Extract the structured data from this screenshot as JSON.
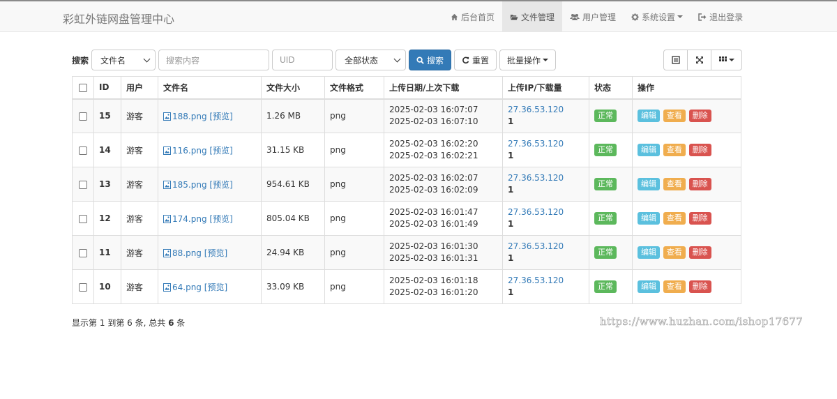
{
  "app": {
    "title": "彩虹外链网盘管理中心"
  },
  "nav": {
    "items": [
      {
        "label": "后台首页",
        "icon": "home-icon"
      },
      {
        "label": "文件管理",
        "icon": "folder-open-icon",
        "active": true
      },
      {
        "label": "用户管理",
        "icon": "users-icon"
      },
      {
        "label": "系统设置",
        "icon": "gear-icon",
        "dropdown": true
      },
      {
        "label": "退出登录",
        "icon": "logout-icon"
      }
    ]
  },
  "toolbar": {
    "search_label": "搜索",
    "field_select": "文件名",
    "search_placeholder": "搜索内容",
    "uid_placeholder": "UID",
    "status_select": "全部状态",
    "search_button": "搜索",
    "reset_button": "重置",
    "batch_button": "批量操作"
  },
  "table": {
    "headers": [
      "ID",
      "用户",
      "文件名",
      "文件大小",
      "文件格式",
      "上传日期/上次下载",
      "上传IP/下载量",
      "状态",
      "操作"
    ],
    "preview_label": "[预览]",
    "actions": {
      "edit": "编辑",
      "view": "查看",
      "delete": "删除"
    },
    "rows": [
      {
        "id": "15",
        "user": "游客",
        "filename": "188.png",
        "size": "1.26 MB",
        "format": "png",
        "upload": "2025-02-03 16:07:07",
        "last_download": "2025-02-03 16:07:10",
        "ip": "27.36.53.120",
        "downloads": "1",
        "status": "正常"
      },
      {
        "id": "14",
        "user": "游客",
        "filename": "116.png",
        "size": "31.15 KB",
        "format": "png",
        "upload": "2025-02-03 16:02:20",
        "last_download": "2025-02-03 16:02:21",
        "ip": "27.36.53.120",
        "downloads": "1",
        "status": "正常"
      },
      {
        "id": "13",
        "user": "游客",
        "filename": "185.png",
        "size": "954.61 KB",
        "format": "png",
        "upload": "2025-02-03 16:02:07",
        "last_download": "2025-02-03 16:02:09",
        "ip": "27.36.53.120",
        "downloads": "1",
        "status": "正常"
      },
      {
        "id": "12",
        "user": "游客",
        "filename": "174.png",
        "size": "805.04 KB",
        "format": "png",
        "upload": "2025-02-03 16:01:47",
        "last_download": "2025-02-03 16:01:49",
        "ip": "27.36.53.120",
        "downloads": "1",
        "status": "正常"
      },
      {
        "id": "11",
        "user": "游客",
        "filename": "88.png",
        "size": "24.94 KB",
        "format": "png",
        "upload": "2025-02-03 16:01:30",
        "last_download": "2025-02-03 16:01:31",
        "ip": "27.36.53.120",
        "downloads": "1",
        "status": "正常"
      },
      {
        "id": "10",
        "user": "游客",
        "filename": "64.png",
        "size": "33.09 KB",
        "format": "png",
        "upload": "2025-02-03 16:01:18",
        "last_download": "2025-02-03 16:01:20",
        "ip": "27.36.53.120",
        "downloads": "1",
        "status": "正常"
      }
    ]
  },
  "pagination": {
    "prefix": "显示第",
    "from": "1",
    "mid": "到第",
    "to": "6",
    "mid2": "条, 总共",
    "total": "6",
    "suffix": "条"
  },
  "watermark": "https://www.huzhan.com/ishop17677",
  "colors": {
    "primary": "#337ab7",
    "success": "#5cb85c",
    "info": "#5bc0de",
    "warning": "#f0ad4e",
    "danger": "#d9534f"
  }
}
